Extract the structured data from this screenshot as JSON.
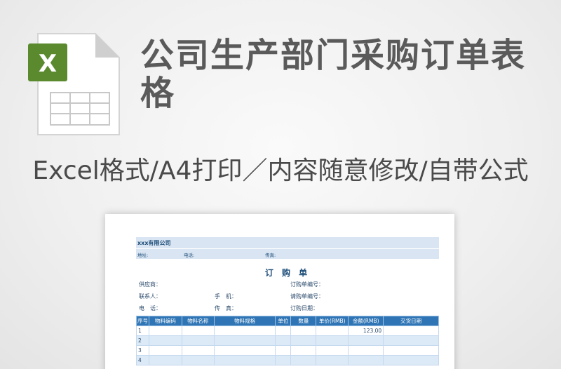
{
  "colors": {
    "icon_badge": "#5b8a2e",
    "headline": "#5a5a5a",
    "table_header": "#2f75b5",
    "row_band": "#dce9f6"
  },
  "icon": {
    "name": "excel-file-icon",
    "letter": "X"
  },
  "headline": "公司生产部门采购订单表格",
  "subline": "Excel格式/A4打印／内容随意修改/自带公式",
  "sheet": {
    "company": "xxx有限公司",
    "address_label": "地址:",
    "phone_label": "电话:",
    "fax_label": "传真:",
    "doc_title": "订 购 单",
    "info": [
      {
        "left": "供应商：",
        "mid": "",
        "right": "订购单编号："
      },
      {
        "left": "联系人：",
        "mid": "手　机：",
        "right": "请购单编号："
      },
      {
        "left": "电　话：",
        "mid": "传　真：",
        "right": "订购日期："
      }
    ],
    "columns": [
      "序号",
      "物料编码",
      "物料名称",
      "物料规格",
      "单位",
      "数量",
      "单价(RMB)",
      "金额(RMB)",
      "交货日期"
    ],
    "rows": [
      [
        "1",
        "",
        "",
        "",
        "",
        "",
        "",
        "123.00",
        ""
      ],
      [
        "2",
        "",
        "",
        "",
        "",
        "",
        "",
        "",
        ""
      ],
      [
        "3",
        "",
        "",
        "",
        "",
        "",
        "",
        "",
        ""
      ],
      [
        "4",
        "",
        "",
        "",
        "",
        "",
        "",
        "",
        ""
      ]
    ]
  }
}
